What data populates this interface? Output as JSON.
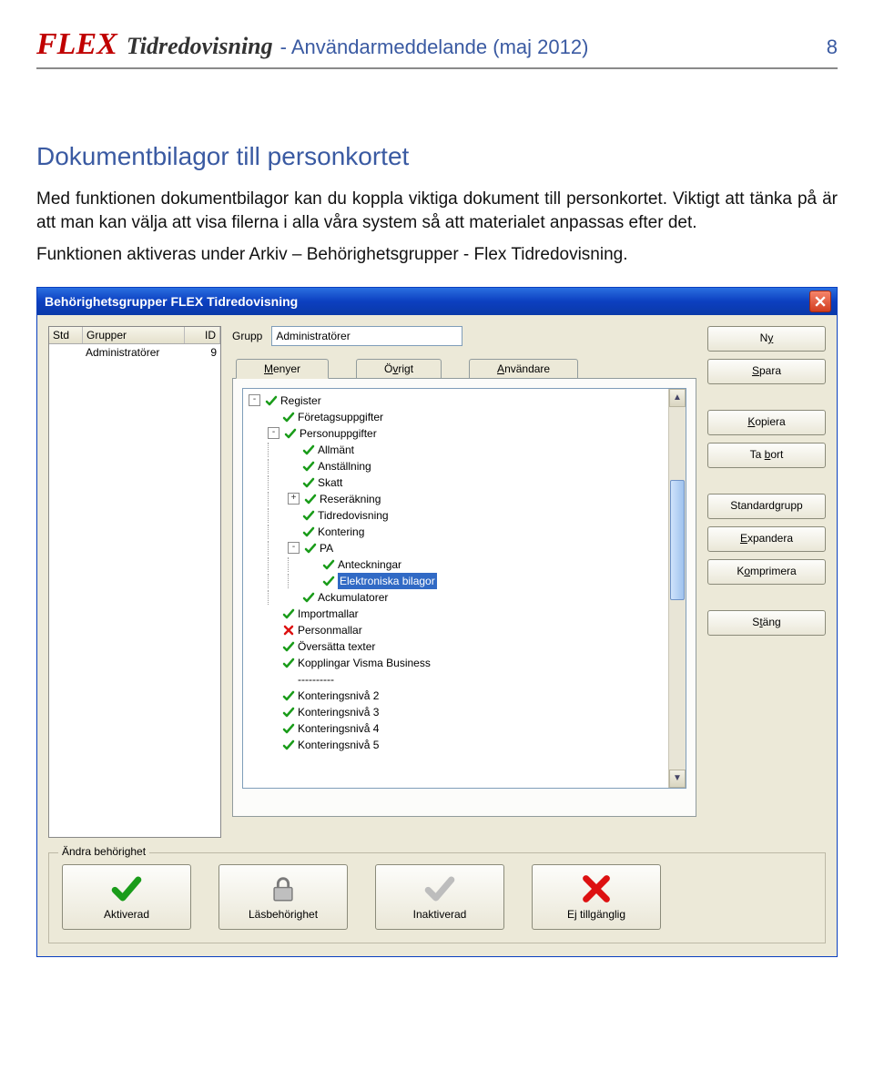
{
  "header": {
    "logo": "FLEX",
    "title": "Tidredovisning",
    "subtitle": "- Användarmeddelande (maj 2012)",
    "page": "8"
  },
  "section_heading": "Dokumentbilagor till personkortet",
  "paragraphs": [
    "Med funktionen dokumentbilagor kan du koppla viktiga dokument till personkortet. Viktigt att tänka på är att man kan välja att visa filerna i alla våra system så att materialet anpassas efter det.",
    "Funktionen aktiveras under Arkiv – Behörighetsgrupper - Flex Tidredovisning."
  ],
  "window": {
    "title": "Behörighetsgrupper FLEX Tidredovisning",
    "grid": {
      "headers": {
        "std": "Std",
        "grupper": "Grupper",
        "id": "ID"
      },
      "rows": [
        {
          "std": "",
          "grupper": "Administratörer",
          "id": "9"
        }
      ]
    },
    "grupp_label": "Grupp",
    "grupp_value": "Administratörer",
    "tabs": {
      "menyer": "Menyer",
      "ovrigt": "Övrigt",
      "anvandare": "Användare"
    },
    "tree": [
      {
        "lvl": 0,
        "exp": "-",
        "chk": "green",
        "label": "Register"
      },
      {
        "lvl": 1,
        "exp": "",
        "chk": "green",
        "label": "Företagsuppgifter"
      },
      {
        "lvl": 1,
        "exp": "-",
        "chk": "green",
        "label": "Personuppgifter"
      },
      {
        "lvl": 2,
        "exp": "",
        "chk": "green",
        "label": "Allmänt"
      },
      {
        "lvl": 2,
        "exp": "",
        "chk": "green",
        "label": "Anställning"
      },
      {
        "lvl": 2,
        "exp": "",
        "chk": "green",
        "label": "Skatt"
      },
      {
        "lvl": 2,
        "exp": "+",
        "chk": "green",
        "label": "Reseräkning"
      },
      {
        "lvl": 2,
        "exp": "",
        "chk": "green",
        "label": "Tidredovisning"
      },
      {
        "lvl": 2,
        "exp": "",
        "chk": "green",
        "label": "Kontering"
      },
      {
        "lvl": 2,
        "exp": "-",
        "chk": "green",
        "label": "PA"
      },
      {
        "lvl": 3,
        "exp": "",
        "chk": "green",
        "label": "Anteckningar"
      },
      {
        "lvl": 3,
        "exp": "",
        "chk": "green",
        "label": "Elektroniska bilagor",
        "selected": true
      },
      {
        "lvl": 2,
        "exp": "",
        "chk": "green",
        "label": "Ackumulatorer"
      },
      {
        "lvl": 1,
        "exp": "",
        "chk": "green",
        "label": "Importmallar"
      },
      {
        "lvl": 1,
        "exp": "",
        "chk": "red",
        "label": "Personmallar"
      },
      {
        "lvl": 1,
        "exp": "",
        "chk": "green",
        "label": "Översätta texter"
      },
      {
        "lvl": 1,
        "exp": "",
        "chk": "green",
        "label": "Kopplingar Visma Business"
      },
      {
        "lvl": 1,
        "exp": "",
        "chk": "",
        "label": "----------"
      },
      {
        "lvl": 1,
        "exp": "",
        "chk": "green",
        "label": "Konteringsnivå 2"
      },
      {
        "lvl": 1,
        "exp": "",
        "chk": "green",
        "label": "Konteringsnivå 3"
      },
      {
        "lvl": 1,
        "exp": "",
        "chk": "green",
        "label": "Konteringsnivå 4"
      },
      {
        "lvl": 1,
        "exp": "",
        "chk": "green",
        "label": "Konteringsnivå 5"
      }
    ],
    "buttons": {
      "ny": "Ny",
      "spara": "Spara",
      "kopiera": "Kopiera",
      "tabort": "Ta bort",
      "standardgrupp": "Standardgrupp",
      "expandera": "Expandera",
      "komprimera": "Komprimera",
      "stang": "Stäng"
    },
    "bottom": {
      "legend": "Ändra behörighet",
      "aktiverad": "Aktiverad",
      "lasbehorighet": "Läsbehörighet",
      "inaktiverad": "Inaktiverad",
      "ejtillganglig": "Ej tillgänglig"
    }
  }
}
